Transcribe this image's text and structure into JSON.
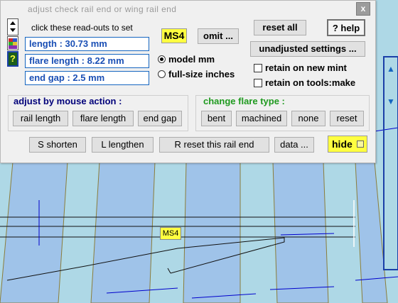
{
  "window": {
    "title": "adjust  check  rail  end  or  wing  rail  end",
    "close_glyph": "x"
  },
  "instructions": "click these read-outs to set",
  "readouts": {
    "length": "length :  30.73 mm",
    "flare_length": "flare length :  8.22 mm",
    "end_gap": "end gap :  2.5 mm"
  },
  "gauge_badge": "MS4",
  "buttons": {
    "omit": "omit ...",
    "reset_all": "reset  all",
    "help": "? help",
    "unadjusted_settings": "unadjusted  settings ...",
    "shorten": "S  shorten",
    "lengthen": "L  lengthen",
    "reset_rail_end": "R  reset  this  rail  end",
    "data": "data ...",
    "hide": "hide"
  },
  "units": {
    "model_mm": "model mm",
    "full_size_inches": "full-size inches",
    "selected": "model_mm"
  },
  "retain": {
    "new_mint": "retain on new mint",
    "tools_make": "retain on tools:make"
  },
  "mouse_action": {
    "title": "adjust by mouse  action :",
    "rail_length": "rail length",
    "flare_length": "flare length",
    "end_gap": "end gap"
  },
  "flare_type": {
    "title": "change flare type :",
    "bent": "bent",
    "machined": "machined",
    "none": "none",
    "reset": "reset"
  },
  "canvas_badge": "MS4",
  "side_toolbar": {
    "up_glyph": "▲",
    "down_glyph": "▼"
  },
  "colors": {
    "accent_blue": "#1565c0",
    "readout_text": "#1a4fb5",
    "badge_yellow": "#ffff40",
    "group_green": "#1f9a1f",
    "group_blue": "#00007a",
    "canvas_bg": "#aed8e6",
    "timber": "#9fc3e9",
    "rail_line": "#111111"
  }
}
